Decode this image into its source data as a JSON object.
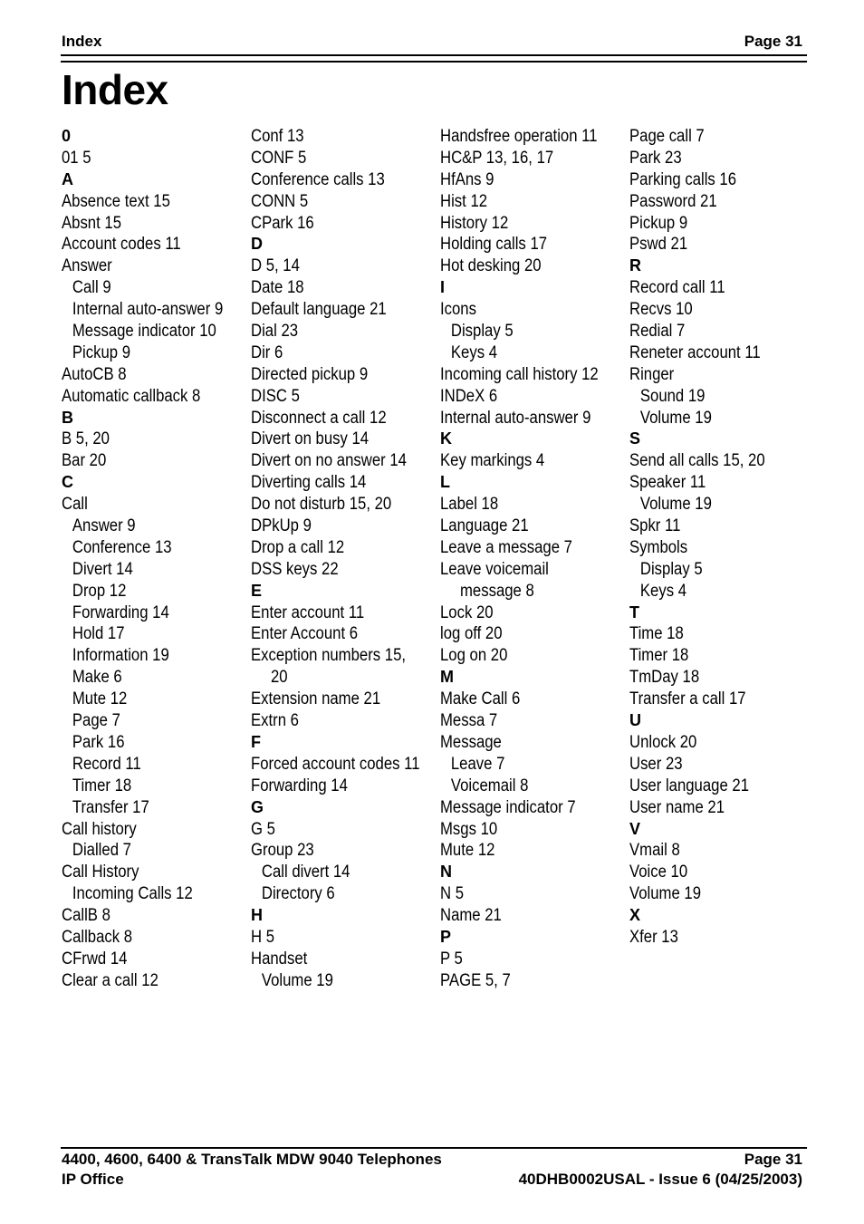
{
  "header": {
    "left": "Index",
    "right": "Page 31"
  },
  "title": "Index",
  "columns": [
    [
      {
        "t": "h",
        "text": "0"
      },
      {
        "t": "e",
        "text": "01 5"
      },
      {
        "t": "h",
        "text": "A"
      },
      {
        "t": "e",
        "text": "Absence text 15"
      },
      {
        "t": "e",
        "text": "Absnt 15"
      },
      {
        "t": "e",
        "text": "Account codes 11"
      },
      {
        "t": "e",
        "text": "Answer"
      },
      {
        "t": "s",
        "text": "Call 9"
      },
      {
        "t": "s",
        "text": "Internal auto-answer 9"
      },
      {
        "t": "s",
        "text": "Message indicator 10"
      },
      {
        "t": "s",
        "text": "Pickup 9"
      },
      {
        "t": "e",
        "text": "AutoCB 8"
      },
      {
        "t": "e",
        "text": "Automatic callback 8"
      },
      {
        "t": "h",
        "text": "B"
      },
      {
        "t": "e",
        "text": "B 5, 20"
      },
      {
        "t": "e",
        "text": "Bar 20"
      },
      {
        "t": "h",
        "text": "C"
      },
      {
        "t": "e",
        "text": "Call"
      },
      {
        "t": "s",
        "text": "Answer 9"
      },
      {
        "t": "s",
        "text": "Conference 13"
      },
      {
        "t": "s",
        "text": "Divert 14"
      },
      {
        "t": "s",
        "text": "Drop 12"
      },
      {
        "t": "s",
        "text": "Forwarding 14"
      },
      {
        "t": "s",
        "text": "Hold 17"
      },
      {
        "t": "s",
        "text": "Information 19"
      },
      {
        "t": "s",
        "text": "Make 6"
      },
      {
        "t": "s",
        "text": "Mute 12"
      },
      {
        "t": "s",
        "text": "Page 7"
      },
      {
        "t": "s",
        "text": "Park 16"
      },
      {
        "t": "s",
        "text": "Record 11"
      },
      {
        "t": "s",
        "text": "Timer 18"
      },
      {
        "t": "s",
        "text": "Transfer 17"
      },
      {
        "t": "e",
        "text": "Call history"
      },
      {
        "t": "s",
        "text": "Dialled 7"
      },
      {
        "t": "e",
        "text": "Call History"
      },
      {
        "t": "s",
        "text": "Incoming Calls 12"
      },
      {
        "t": "e",
        "text": "CallB 8"
      },
      {
        "t": "e",
        "text": "Callback 8"
      },
      {
        "t": "e",
        "text": "CFrwd 14"
      },
      {
        "t": "e",
        "text": "Clear a call 12"
      }
    ],
    [
      {
        "t": "e",
        "text": "Conf 13"
      },
      {
        "t": "e",
        "text": "CONF 5"
      },
      {
        "t": "e",
        "text": "Conference calls 13"
      },
      {
        "t": "e",
        "text": "CONN 5"
      },
      {
        "t": "e",
        "text": "CPark 16"
      },
      {
        "t": "h",
        "text": "D"
      },
      {
        "t": "e",
        "text": "D 5, 14"
      },
      {
        "t": "e",
        "text": "Date 18"
      },
      {
        "t": "e",
        "text": "Default language 21"
      },
      {
        "t": "e",
        "text": "Dial 23"
      },
      {
        "t": "e",
        "text": "Dir 6"
      },
      {
        "t": "e",
        "text": "Directed pickup 9"
      },
      {
        "t": "e",
        "text": "DISC 5"
      },
      {
        "t": "e",
        "text": "Disconnect a call 12"
      },
      {
        "t": "e",
        "text": "Divert on busy 14"
      },
      {
        "t": "e",
        "text": "Divert on no answer 14"
      },
      {
        "t": "e",
        "text": "Diverting calls 14"
      },
      {
        "t": "e",
        "text": "Do not disturb 15, 20"
      },
      {
        "t": "e",
        "text": "DPkUp 9"
      },
      {
        "t": "e",
        "text": "Drop a call 12"
      },
      {
        "t": "e",
        "text": "DSS keys 22"
      },
      {
        "t": "h",
        "text": "E"
      },
      {
        "t": "e",
        "text": "Enter account 11"
      },
      {
        "t": "e",
        "text": "Enter Account 6"
      },
      {
        "t": "e",
        "text": "Exception numbers 15,"
      },
      {
        "t": "c",
        "text": "20"
      },
      {
        "t": "e",
        "text": "Extension name 21"
      },
      {
        "t": "e",
        "text": "Extrn 6"
      },
      {
        "t": "h",
        "text": "F"
      },
      {
        "t": "e",
        "text": "Forced account codes 11"
      },
      {
        "t": "e",
        "text": "Forwarding 14"
      },
      {
        "t": "h",
        "text": "G"
      },
      {
        "t": "e",
        "text": "G 5"
      },
      {
        "t": "e",
        "text": "Group 23"
      },
      {
        "t": "s",
        "text": "Call divert 14"
      },
      {
        "t": "s",
        "text": "Directory 6"
      },
      {
        "t": "h",
        "text": "H"
      },
      {
        "t": "e",
        "text": "H 5"
      },
      {
        "t": "e",
        "text": "Handset"
      },
      {
        "t": "s",
        "text": "Volume 19"
      }
    ],
    [
      {
        "t": "e",
        "text": "Handsfree operation 11"
      },
      {
        "t": "e",
        "text": "HC&P 13, 16, 17"
      },
      {
        "t": "e",
        "text": "HfAns 9"
      },
      {
        "t": "e",
        "text": "Hist 12"
      },
      {
        "t": "e",
        "text": "History 12"
      },
      {
        "t": "e",
        "text": "Holding calls 17"
      },
      {
        "t": "e",
        "text": "Hot desking 20"
      },
      {
        "t": "h",
        "text": "I"
      },
      {
        "t": "e",
        "text": "Icons"
      },
      {
        "t": "s",
        "text": "Display 5"
      },
      {
        "t": "s",
        "text": "Keys 4"
      },
      {
        "t": "e",
        "text": "Incoming call history 12"
      },
      {
        "t": "e",
        "text": "INDeX 6"
      },
      {
        "t": "e",
        "text": "Internal auto-answer 9"
      },
      {
        "t": "h",
        "text": "K"
      },
      {
        "t": "e",
        "text": "Key markings 4"
      },
      {
        "t": "h",
        "text": "L"
      },
      {
        "t": "e",
        "text": "Label 18"
      },
      {
        "t": "e",
        "text": "Language 21"
      },
      {
        "t": "e",
        "text": "Leave a message 7"
      },
      {
        "t": "e",
        "text": "Leave voicemail"
      },
      {
        "t": "c",
        "text": "message 8"
      },
      {
        "t": "e",
        "text": "Lock 20"
      },
      {
        "t": "e",
        "text": "log off 20"
      },
      {
        "t": "e",
        "text": "Log on 20"
      },
      {
        "t": "h",
        "text": "M"
      },
      {
        "t": "e",
        "text": "Make Call 6"
      },
      {
        "t": "e",
        "text": "Messa 7"
      },
      {
        "t": "e",
        "text": "Message"
      },
      {
        "t": "s",
        "text": "Leave 7"
      },
      {
        "t": "s",
        "text": "Voicemail 8"
      },
      {
        "t": "e",
        "text": "Message indicator 7"
      },
      {
        "t": "e",
        "text": "Msgs 10"
      },
      {
        "t": "e",
        "text": "Mute 12"
      },
      {
        "t": "h",
        "text": "N"
      },
      {
        "t": "e",
        "text": "N 5"
      },
      {
        "t": "e",
        "text": "Name 21"
      },
      {
        "t": "h",
        "text": "P"
      },
      {
        "t": "e",
        "text": "P 5"
      },
      {
        "t": "e",
        "text": "PAGE 5, 7"
      }
    ],
    [
      {
        "t": "e",
        "text": "Page call 7"
      },
      {
        "t": "e",
        "text": "Park 23"
      },
      {
        "t": "e",
        "text": "Parking calls 16"
      },
      {
        "t": "e",
        "text": "Password 21"
      },
      {
        "t": "e",
        "text": "Pickup 9"
      },
      {
        "t": "e",
        "text": "Pswd 21"
      },
      {
        "t": "h",
        "text": "R"
      },
      {
        "t": "e",
        "text": "Record call 11"
      },
      {
        "t": "e",
        "text": "Recvs 10"
      },
      {
        "t": "e",
        "text": "Redial 7"
      },
      {
        "t": "e",
        "text": "Reneter account 11"
      },
      {
        "t": "e",
        "text": "Ringer"
      },
      {
        "t": "s",
        "text": "Sound 19"
      },
      {
        "t": "s",
        "text": "Volume 19"
      },
      {
        "t": "h",
        "text": "S"
      },
      {
        "t": "e",
        "text": "Send all calls 15, 20"
      },
      {
        "t": "e",
        "text": "Speaker 11"
      },
      {
        "t": "s",
        "text": "Volume 19"
      },
      {
        "t": "e",
        "text": "Spkr 11"
      },
      {
        "t": "e",
        "text": "Symbols"
      },
      {
        "t": "s",
        "text": "Display 5"
      },
      {
        "t": "s",
        "text": "Keys 4"
      },
      {
        "t": "h",
        "text": "T"
      },
      {
        "t": "e",
        "text": "Time 18"
      },
      {
        "t": "e",
        "text": "Timer 18"
      },
      {
        "t": "e",
        "text": "TmDay 18"
      },
      {
        "t": "e",
        "text": "Transfer a call 17"
      },
      {
        "t": "h",
        "text": "U"
      },
      {
        "t": "e",
        "text": "Unlock 20"
      },
      {
        "t": "e",
        "text": "User 23"
      },
      {
        "t": "e",
        "text": "User language 21"
      },
      {
        "t": "e",
        "text": "User name 21"
      },
      {
        "t": "h",
        "text": "V"
      },
      {
        "t": "e",
        "text": "Vmail 8"
      },
      {
        "t": "e",
        "text": "Voice 10"
      },
      {
        "t": "e",
        "text": "Volume 19"
      },
      {
        "t": "h",
        "text": "X"
      },
      {
        "t": "e",
        "text": "Xfer 13"
      }
    ]
  ],
  "footer": {
    "line1_left": "4400, 4600, 6400 & TransTalk MDW 9040 Telephones",
    "line1_right": "Page 31",
    "line2_left": "IP Office",
    "line2_right": "40DHB0002USAL - Issue 6 (04/25/2003)"
  }
}
